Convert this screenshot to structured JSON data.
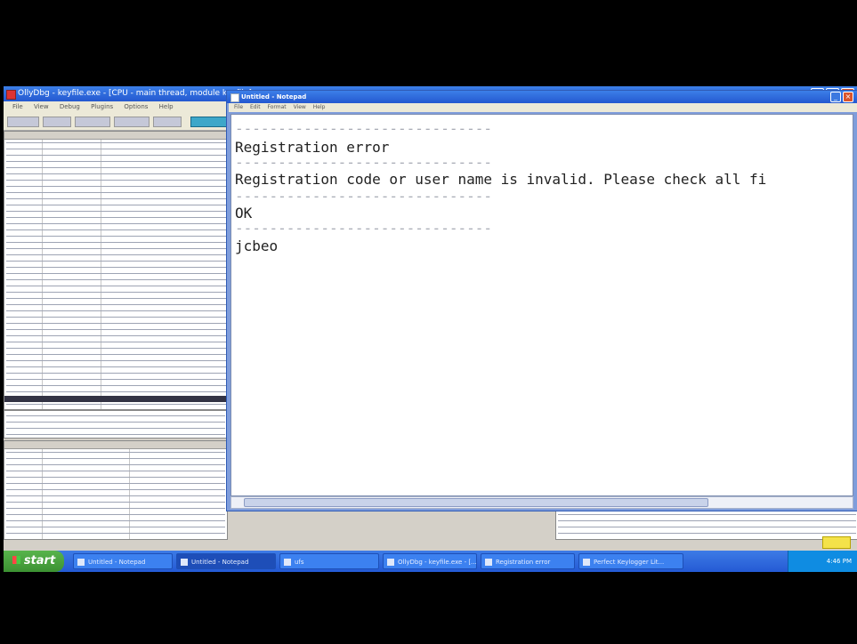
{
  "olly": {
    "title": "OllyDbg - keyfile.exe - [CPU - main thread, module keyfile]",
    "menu": [
      "File",
      "View",
      "Debug",
      "Plugins",
      "Options",
      "Help"
    ]
  },
  "notepad": {
    "title": "Untitled - Notepad",
    "menu": [
      "File",
      "Edit",
      "Format",
      "View",
      "Help"
    ],
    "lines": [
      "------------------------------",
      "Registration error",
      "------------------------------",
      "Registration code or user name is invalid. Please check all fi",
      "------------------------------",
      "OK",
      "------------------------------",
      "jcbeo"
    ]
  },
  "taskbar": {
    "start_label": "start",
    "tasks": [
      {
        "label": "Untitled - Notepad",
        "active": false
      },
      {
        "label": "Untitled - Notepad",
        "active": true
      },
      {
        "label": "ufs",
        "active": false
      },
      {
        "label": "OllyDbg - keyfile.exe - [...",
        "active": false
      },
      {
        "label": "Registration error",
        "active": false
      },
      {
        "label": "Perfect Keylogger Lit...",
        "active": false
      }
    ],
    "clock": "4:46 PM"
  },
  "colors": {
    "titlebar": "#245ad4",
    "taskbar": "#245ad4",
    "start": "#3c9132"
  }
}
